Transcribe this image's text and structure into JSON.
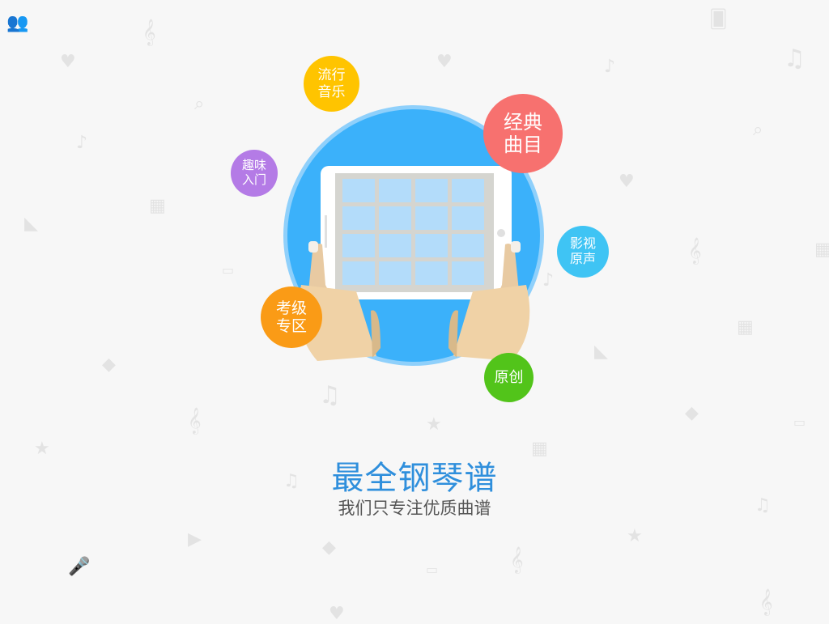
{
  "bubbles": {
    "pop": {
      "line1": "流行",
      "line2": "音乐",
      "color": "#ffc400"
    },
    "classic": {
      "line1": "经典",
      "line2": "曲目",
      "color": "#f7716f"
    },
    "fun": {
      "line1": "趣味",
      "line2": "入门",
      "color": "#b47be6"
    },
    "film": {
      "line1": "影视",
      "line2": "原声",
      "color": "#3fc4f4"
    },
    "exam": {
      "line1": "考级",
      "line2": "专区",
      "color": "#fa9b16"
    },
    "original": {
      "line1": "原创",
      "color": "#52c41a"
    }
  },
  "hero": {
    "circle_color": "#3bb1fa",
    "ring_color": "#8fd0fb",
    "tile_color": "#b3dcfa"
  },
  "headline": {
    "title": "最全钢琴谱",
    "subtitle": "我们只专注优质曲谱"
  }
}
